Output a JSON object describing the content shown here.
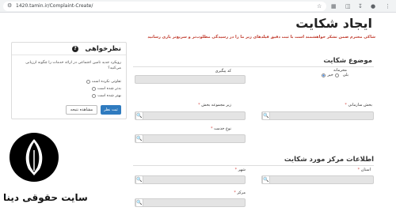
{
  "browser": {
    "url": "1420.tamin.ir/Complaint-Create/",
    "icons": [
      "tune-icon",
      "star-icon",
      "puzzle-icon",
      "sidebar-icon",
      "download-icon",
      "profile-icon",
      "more-icon"
    ]
  },
  "page": {
    "title": "ایجاد شکایت",
    "notice": "شاکی محترم ضمن تشکر خواهشمند است با ثبت دقیق فیلدهای زیر ما را در رسیدگی مطلوب‌تر و سریع‌تر یاری رسانید"
  },
  "complaint_subject": {
    "title": "موضوع شکایت",
    "confidential_label": "محرمانه",
    "radio_yes": "بلی",
    "radio_no": "خیر",
    "tracking_code_label": "کد پیگیری",
    "org_section_label": "بخش سازمانی",
    "sub_section_label": "زیر مجموعه بخش",
    "service_type_label": "نوع خدمت"
  },
  "center_info": {
    "title": "اطلاعات مرکز مورد شکایت",
    "province_label": "استان",
    "city_label": "شهر",
    "center_label": "مرکز"
  },
  "survey": {
    "title": "نظرخواهی",
    "question": "رویکرد جدید تامین اجتماعی در ارائه خدمات را چگونه ارزیابی می‌کنید؟",
    "options": [
      "تفاوتی نکرده است",
      "بدتر شده است",
      "بهتر شده است"
    ],
    "submit_label": "ثبت نظر",
    "results_label": "مشاهده نتیجه"
  },
  "watermark": {
    "text": "سایت حقوقی دینا"
  },
  "colors": {
    "accent": "#2f7bbf",
    "required": "#d9534f",
    "notice": "#c0392b"
  }
}
